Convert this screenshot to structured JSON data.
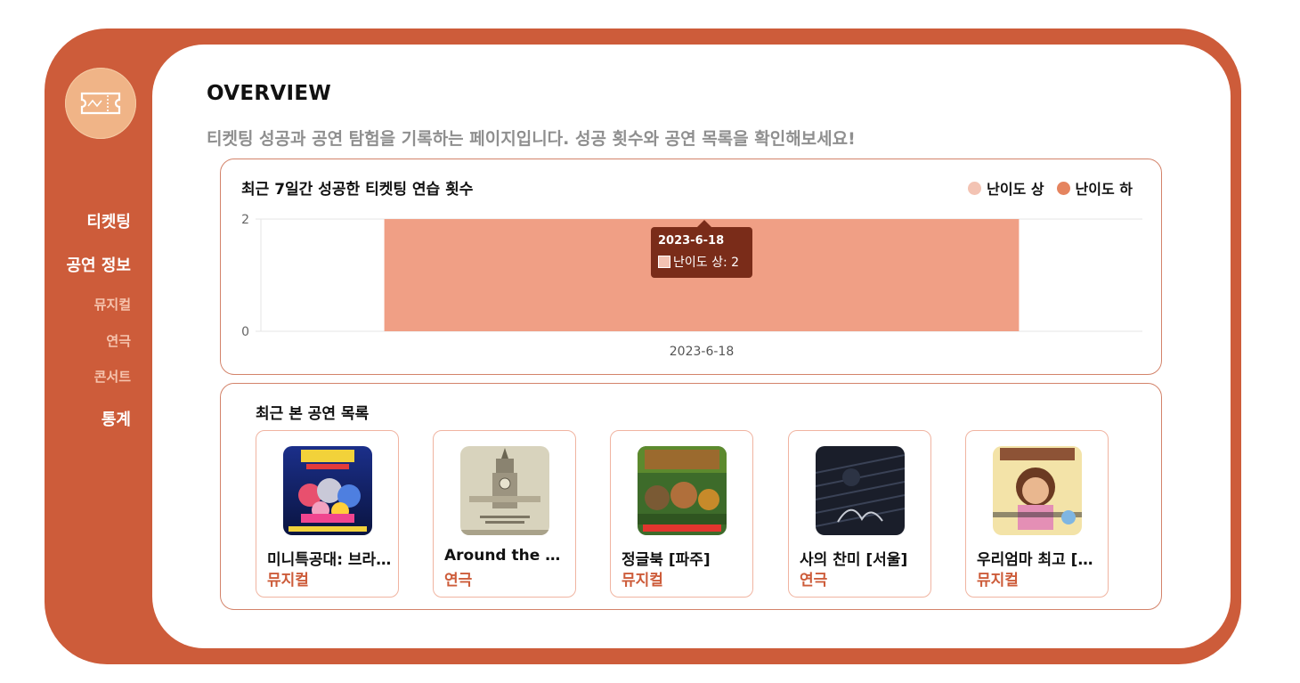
{
  "header": {
    "title": "OVERVIEW",
    "subtitle": "티켓팅 성공과 공연 탐험을 기록하는 페이지입니다. 성공 횟수와 공연 목록을 확인해보세요!"
  },
  "sidebar": {
    "logo_icon": "ticket-icon",
    "items": [
      {
        "label": "티켓팅",
        "level": "main"
      },
      {
        "label": "공연 정보",
        "level": "main"
      },
      {
        "label": "뮤지컬",
        "level": "sub"
      },
      {
        "label": "연극",
        "level": "sub"
      },
      {
        "label": "콘서트",
        "level": "sub"
      },
      {
        "label": "통계",
        "level": "main"
      }
    ]
  },
  "chart_card": {
    "title": "최근 7일간 성공한 티켓팅 연습 횟수",
    "tooltip": {
      "date": "2023-6-18",
      "label": "난이도 상: 2"
    }
  },
  "chart_data": {
    "type": "bar",
    "categories": [
      "2023-6-18"
    ],
    "series": [
      {
        "name": "난이도 상",
        "values": [
          2
        ],
        "color": "#f3c3b3"
      },
      {
        "name": "난이도 하",
        "values": [
          0
        ],
        "color": "#e5845f"
      }
    ],
    "ylim": [
      0,
      2
    ],
    "yticks": [
      "0",
      "2"
    ],
    "legend": "top-right",
    "grid": true
  },
  "recent_list": {
    "title": "최근 본 공연 목록",
    "items": [
      {
        "name": "미니특공대: 브라이트 히어로즈",
        "genre": "뮤지컬"
      },
      {
        "name": "Around the Clock",
        "genre": "연극"
      },
      {
        "name": "정글북 [파주]",
        "genre": "뮤지컬"
      },
      {
        "name": "사의 찬미 [서울]",
        "genre": "연극"
      },
      {
        "name": "우리엄마 최고 [서울]",
        "genre": "뮤지컬"
      }
    ]
  },
  "colors": {
    "brand": "#cd5c3a",
    "bar_main": "#f09f85",
    "tooltip_bg": "#7a2c19",
    "legend_high": "#f3c3b3",
    "legend_low": "#e5845f"
  }
}
